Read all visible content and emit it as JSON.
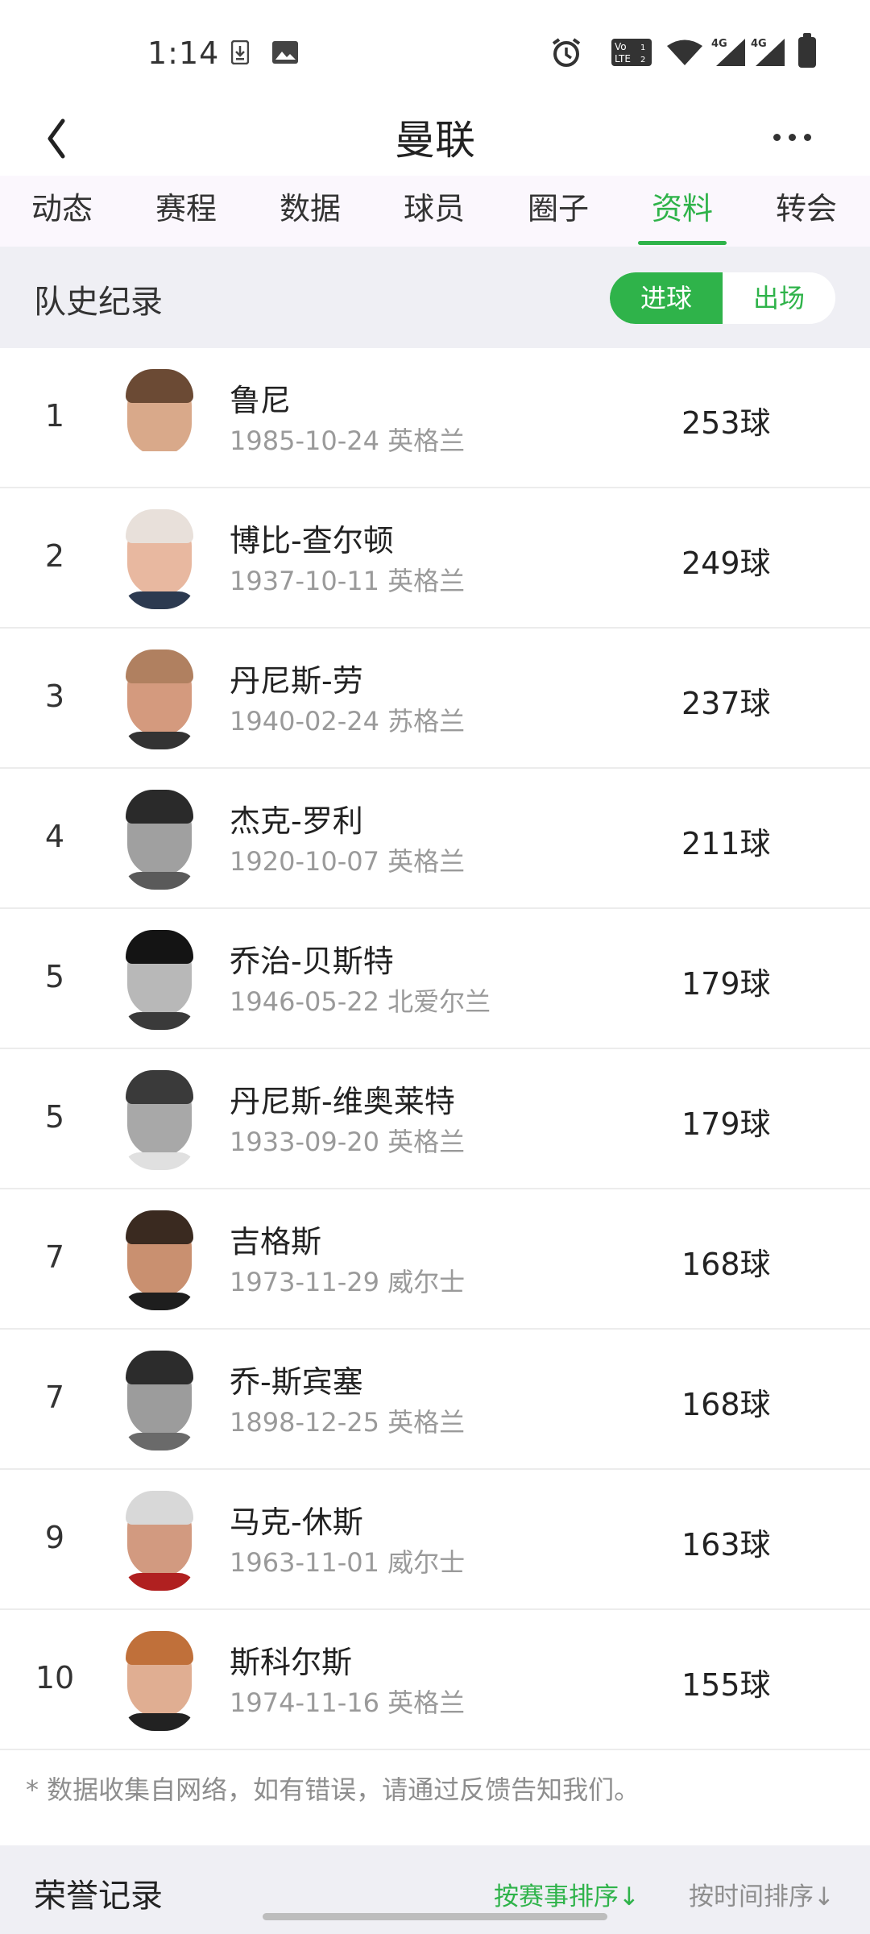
{
  "status_bar": {
    "time": "1:14",
    "icons": [
      "download-icon",
      "image-icon",
      "alarm-icon",
      "volte-icon",
      "wifi-icon",
      "signal-4g-icon",
      "signal-4g-icon",
      "battery-icon"
    ],
    "volte_text": "Vo LTE",
    "network_label_1": "4G",
    "network_label_2": "4G"
  },
  "header": {
    "title": "曼联",
    "back_icon": "chevron-left-icon",
    "more_icon": "more-horizontal-icon"
  },
  "tabs": [
    {
      "label": "动态",
      "active": false
    },
    {
      "label": "赛程",
      "active": false
    },
    {
      "label": "数据",
      "active": false
    },
    {
      "label": "球员",
      "active": false
    },
    {
      "label": "圈子",
      "active": false
    },
    {
      "label": "资料",
      "active": true
    },
    {
      "label": "转会",
      "active": false
    }
  ],
  "records": {
    "title": "队史纪录",
    "toggle": {
      "goals": "进球",
      "appearances": "出场",
      "selected": "进球"
    },
    "players": [
      {
        "rank": "1",
        "name": "鲁尼",
        "meta": "1985-10-24 英格兰",
        "goals": "253球",
        "skin": "#d9a98a",
        "hair": "#6b4a34",
        "shirt": "#ffffff"
      },
      {
        "rank": "2",
        "name": "博比-查尔顿",
        "meta": "1937-10-11 英格兰",
        "goals": "249球",
        "skin": "#e8b8a0",
        "hair": "#e8e0da",
        "shirt": "#2c3a50"
      },
      {
        "rank": "3",
        "name": "丹尼斯-劳",
        "meta": "1940-02-24 苏格兰",
        "goals": "237球",
        "skin": "#d49a7e",
        "hair": "#b08060",
        "shirt": "#333333"
      },
      {
        "rank": "4",
        "name": "杰克-罗利",
        "meta": "1920-10-07 英格兰",
        "goals": "211球",
        "skin": "#a0a0a0",
        "hair": "#2a2a2a",
        "shirt": "#5a5a5a"
      },
      {
        "rank": "5",
        "name": "乔治-贝斯特",
        "meta": "1946-05-22 北爱尔兰",
        "goals": "179球",
        "skin": "#b8b8b8",
        "hair": "#141414",
        "shirt": "#3a3a3a"
      },
      {
        "rank": "5",
        "name": "丹尼斯-维奥莱特",
        "meta": "1933-09-20 英格兰",
        "goals": "179球",
        "skin": "#a8a8a8",
        "hair": "#3a3a3a",
        "shirt": "#e0e0e0"
      },
      {
        "rank": "7",
        "name": "吉格斯",
        "meta": "1973-11-29 威尔士",
        "goals": "168球",
        "skin": "#c99070",
        "hair": "#3a2a20",
        "shirt": "#1e1e1e"
      },
      {
        "rank": "7",
        "name": "乔-斯宾塞",
        "meta": "1898-12-25 英格兰",
        "goals": "168球",
        "skin": "#9c9c9c",
        "hair": "#2c2c2c",
        "shirt": "#6a6a6a"
      },
      {
        "rank": "9",
        "name": "马克-休斯",
        "meta": "1963-11-01 威尔士",
        "goals": "163球",
        "skin": "#d29a80",
        "hair": "#d8d8d8",
        "shirt": "#b02020"
      },
      {
        "rank": "10",
        "name": "斯科尔斯",
        "meta": "1974-11-16 英格兰",
        "goals": "155球",
        "skin": "#e0ae92",
        "hair": "#c0703a",
        "shirt": "#222222"
      }
    ]
  },
  "note": "* 数据收集自网络，如有错误，请通过反馈告知我们。",
  "honors": {
    "title": "荣誉记录",
    "sort_by_event": "按赛事排序↓",
    "sort_by_time": "按时间排序↓"
  }
}
